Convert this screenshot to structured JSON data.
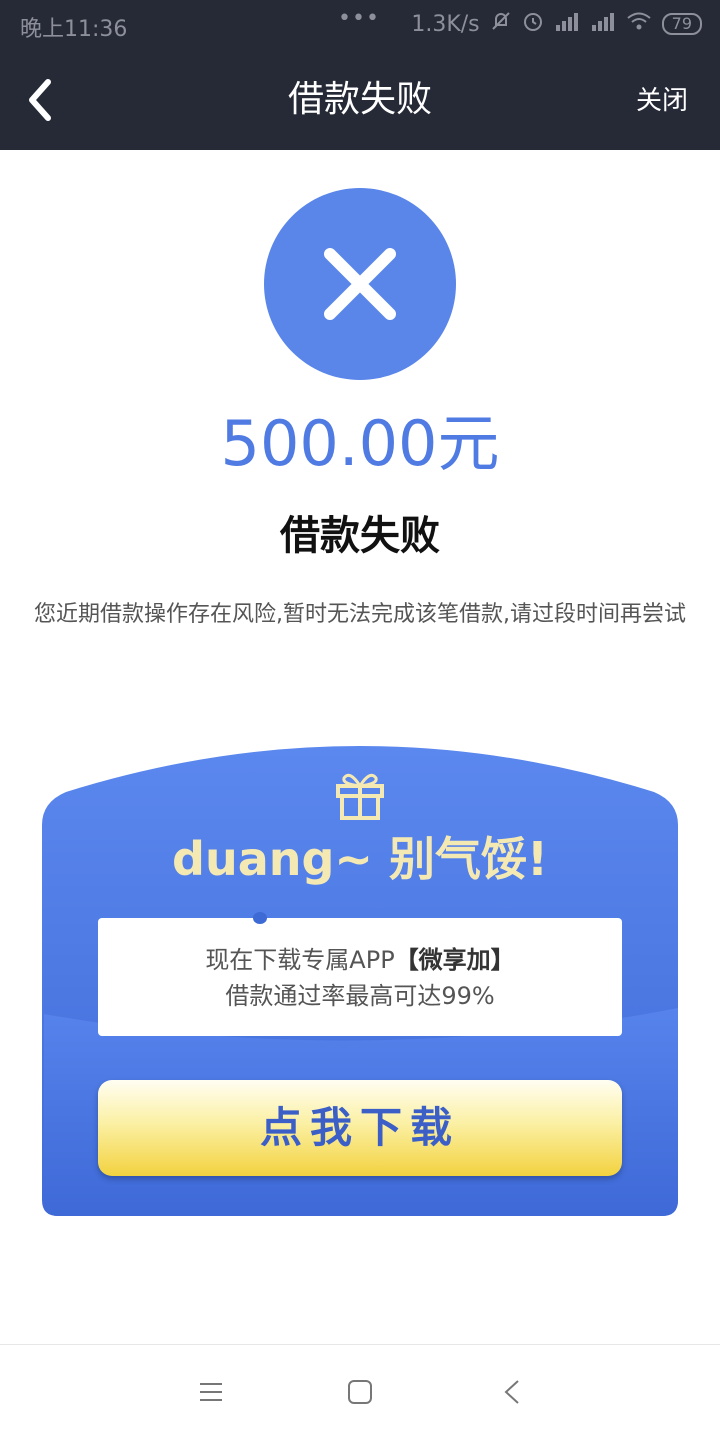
{
  "status_bar": {
    "time": "晚上11:36",
    "dots": "•••",
    "speed": "1.3K/s",
    "battery": "79"
  },
  "nav": {
    "title": "借款失败",
    "close_label": "关闭"
  },
  "result": {
    "amount": "500.00元",
    "title": "借款失败",
    "message": "您近期借款操作存在风险,暂时无法完成该笔借款,请过段时间再尝试"
  },
  "promo": {
    "slogan": "duang~ 别气馁!",
    "line1_prefix": "现在下载专属APP",
    "line1_app": "【微享加】",
    "line2": "借款通过率最高可达99%",
    "button_label": "点我下载"
  },
  "colors": {
    "header_bg": "#262a37",
    "accent_blue": "#4f7be3",
    "card_blue": "#4a78e3",
    "button_yellow": "#f3d23f"
  },
  "icons": [
    "back-arrow-icon",
    "fail-x-icon",
    "gift-icon",
    "menu-icon",
    "home-icon",
    "back-icon"
  ]
}
